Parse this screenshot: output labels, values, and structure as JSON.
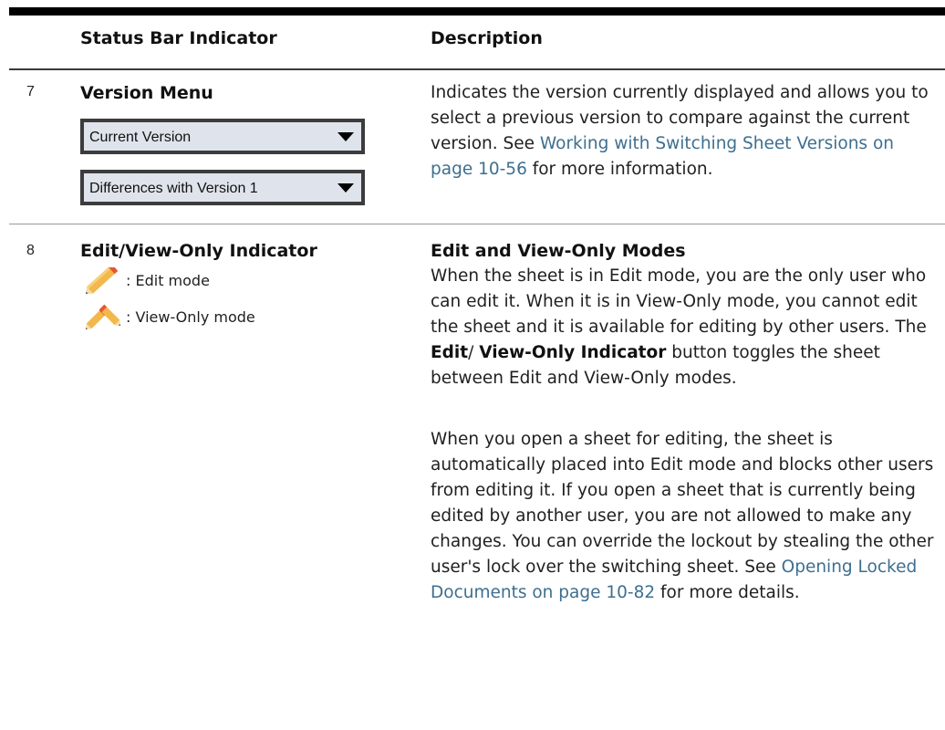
{
  "table": {
    "headers": {
      "indicator": "Status Bar Indicator",
      "description": "Description"
    },
    "rows": [
      {
        "number": "7",
        "title": "Version Menu",
        "dropdowns": [
          {
            "value": "Current Version"
          },
          {
            "value": "Differences with Version 1"
          }
        ],
        "description": {
          "text_before": "Indicates the version currently displayed and allows you to select a previous version to compare against the current version. See ",
          "link": "Working with Switching Sheet Versions on page 10-56",
          "text_after": " for more information."
        }
      },
      {
        "number": "8",
        "title": "Edit/View-Only Indicator",
        "legend": [
          {
            "icon": "pencil-icon",
            "label": ": Edit mode"
          },
          {
            "icon": "pencils-icon",
            "label": ": View-Only mode"
          }
        ],
        "description": {
          "heading": "Edit and View-Only Modes",
          "para1_before": "When the sheet is in Edit mode, you are the only user who can edit it. When it is in View-Only mode, you cannot edit the sheet and it is available for editing by other users. The ",
          "para1_bold1": "Edit",
          "para1_slash": "/ ",
          "para1_bold2": "View-Only Indicator",
          "para1_after": " button toggles the sheet between Edit and View-Only modes.",
          "para2_before": "When you open a sheet for editing, the sheet is automatically placed into Edit mode and blocks other users from editing it. If you open a sheet that is currently being edited by another user, you are not allowed to make any changes. You can override the lockout by stealing the other user's lock over the switching sheet. See ",
          "para2_link": "Opening Locked Documents on page 10-82",
          "para2_after": " for more details."
        }
      }
    ]
  },
  "colors": {
    "link": "#3d6f8f",
    "dropdown_bg": "#dfe4ec",
    "pencil_body": "#f2b84b",
    "pencil_tip": "#e8572f"
  }
}
